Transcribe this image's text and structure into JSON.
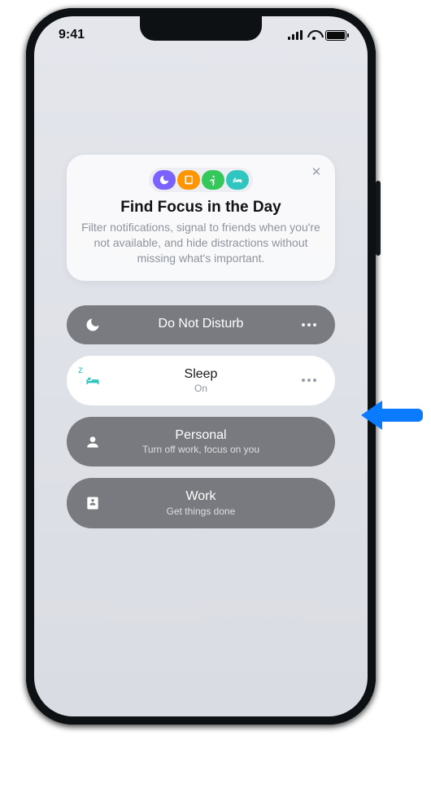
{
  "statusbar": {
    "time": "9:41"
  },
  "tip": {
    "title": "Find Focus in the Day",
    "description": "Filter notifications, signal to friends when you're not available, and hide distractions without missing what's important."
  },
  "focus": {
    "do_not_disturb": {
      "title": "Do Not Disturb"
    },
    "sleep": {
      "title": "Sleep",
      "sub": "On"
    },
    "personal": {
      "title": "Personal",
      "sub": "Turn off work, focus on you"
    },
    "work": {
      "title": "Work",
      "sub": "Get things done"
    }
  }
}
